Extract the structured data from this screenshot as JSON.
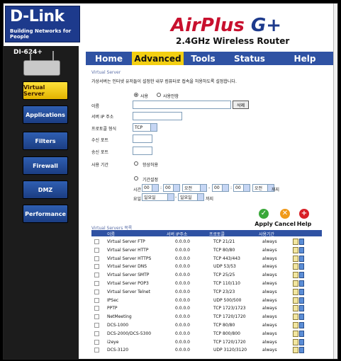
{
  "header": {
    "logo": "D-Link",
    "tagline": "Building Networks for People",
    "brand_left": "AirPlus ",
    "brand_right": "G+",
    "subtitle": "2.4GHz Wireless Router"
  },
  "sidebar": {
    "model": "DI-624+",
    "items": [
      {
        "label": "Virtual Server",
        "active": true
      },
      {
        "label": "Applications"
      },
      {
        "label": "Filters"
      },
      {
        "label": "Firewall"
      },
      {
        "label": "DMZ"
      },
      {
        "label": "Performance"
      }
    ]
  },
  "tabs": [
    {
      "label": "Home"
    },
    {
      "label": "Advanced",
      "active": true
    },
    {
      "label": "Tools"
    },
    {
      "label": "Status"
    },
    {
      "label": "Help"
    }
  ],
  "form": {
    "section_title": "Virtual Server",
    "description": "가상서버는 인터넷 유저들이 설정한 내부 컴퓨터로 접속을 허용하도록 설정합니다.",
    "enable_label": "사용",
    "disable_label": "사용안함",
    "name_label": "이름",
    "name_value": "",
    "delete_label": "삭제",
    "private_ip_label": "서버 IP 주소",
    "private_ip_value": "",
    "protocol_label": "프로토콜 형식",
    "protocol_value": "TCP",
    "private_port_label": "수신 포트",
    "public_port_label": "송신 포트",
    "schedule_label": "사용 기간",
    "always_label": "항상허용",
    "from_label": "기간설정",
    "time_label": "시간",
    "time_from_hour": "00",
    "time_from_min": "00",
    "time_from_ampm": "오전",
    "time_to_hour": "00",
    "time_to_min": "00",
    "time_to_ampm": "오전",
    "until_label": "까지",
    "day_label": "요일",
    "day_from": "일요일",
    "day_to": "일요일",
    "until_label2": "까지"
  },
  "actions": {
    "apply": "Apply",
    "cancel": "Cancel",
    "help": "Help"
  },
  "list": {
    "title": "Virtual Servers 목록",
    "columns": [
      "이름",
      "서버 IP주소",
      "프로토콜",
      "사용기간"
    ],
    "rows": [
      {
        "name": "Virtual Server FTP",
        "ip": "0.0.0.0",
        "proto": "TCP 21/21",
        "sched": "always"
      },
      {
        "name": "Virtual Server HTTP",
        "ip": "0.0.0.0",
        "proto": "TCP 80/80",
        "sched": "always"
      },
      {
        "name": "Virtual Server HTTPS",
        "ip": "0.0.0.0",
        "proto": "TCP 443/443",
        "sched": "always"
      },
      {
        "name": "Virtual Server DNS",
        "ip": "0.0.0.0",
        "proto": "UDP 53/53",
        "sched": "always"
      },
      {
        "name": "Virtual Server SMTP",
        "ip": "0.0.0.0",
        "proto": "TCP 25/25",
        "sched": "always"
      },
      {
        "name": "Virtual Server POP3",
        "ip": "0.0.0.0",
        "proto": "TCP 110/110",
        "sched": "always"
      },
      {
        "name": "Virtual Server Telnet",
        "ip": "0.0.0.0",
        "proto": "TCP 23/23",
        "sched": "always"
      },
      {
        "name": "IPSec",
        "ip": "0.0.0.0",
        "proto": "UDP 500/500",
        "sched": "always"
      },
      {
        "name": "PPTP",
        "ip": "0.0.0.0",
        "proto": "TCP 1723/1723",
        "sched": "always"
      },
      {
        "name": "NetMeeting",
        "ip": "0.0.0.0",
        "proto": "TCP 1720/1720",
        "sched": "always"
      },
      {
        "name": "DCS-1000",
        "ip": "0.0.0.0",
        "proto": "TCP 80/80",
        "sched": "always"
      },
      {
        "name": "DCS-2000/DCS-5300",
        "ip": "0.0.0.0",
        "proto": "TCP 800/800",
        "sched": "always"
      },
      {
        "name": "i2eye",
        "ip": "0.0.0.0",
        "proto": "TCP 1720/1720",
        "sched": "always"
      },
      {
        "name": "DCS-3120",
        "ip": "0.0.0.0",
        "proto": "UDP 3120/3120",
        "sched": "always"
      }
    ]
  }
}
